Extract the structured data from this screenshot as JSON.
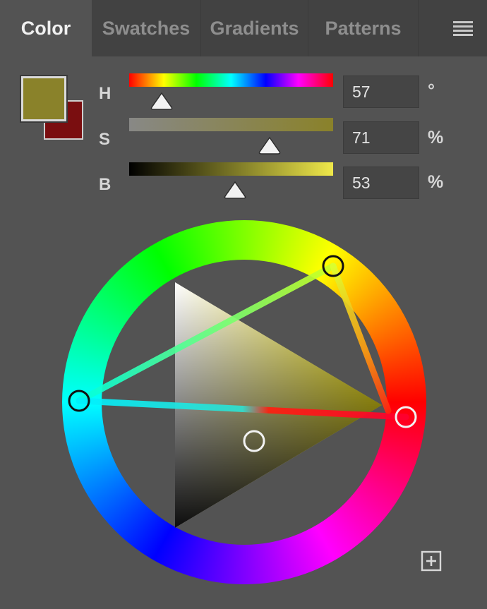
{
  "tabs": [
    {
      "label": "Color",
      "active": true
    },
    {
      "label": "Swatches",
      "active": false
    },
    {
      "label": "Gradients",
      "active": false
    },
    {
      "label": "Patterns",
      "active": false
    }
  ],
  "panel_menu_icon": "hamburger-menu-icon",
  "foreground_color": "#8a822a",
  "background_color": "#7a0e10",
  "sliders": {
    "h": {
      "label": "H",
      "value": "57",
      "unit": "°",
      "fraction": 0.16
    },
    "s": {
      "label": "S",
      "value": "71",
      "unit": "%",
      "fraction": 0.69
    },
    "b": {
      "label": "B",
      "value": "53",
      "unit": "%",
      "fraction": 0.52
    }
  },
  "add_icon": "plus-square-icon"
}
